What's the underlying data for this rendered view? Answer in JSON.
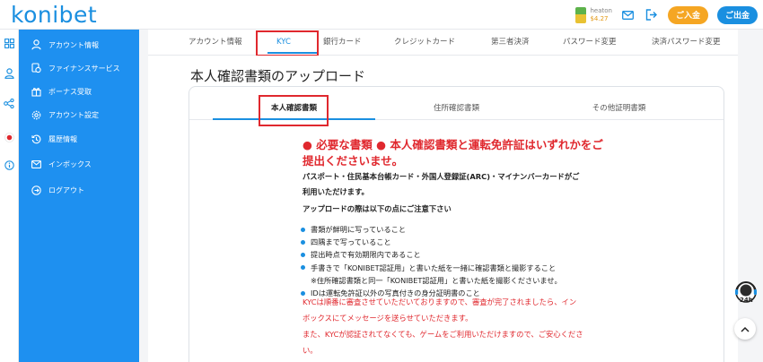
{
  "brand": {
    "logo_text": "konibet",
    "accent": "#1a8fe0",
    "sidebar_bg": "#1e90f0",
    "highlight": "#e0282e"
  },
  "header": {
    "user_name": "heaton",
    "balance": "$4.27",
    "deposit_label": "ご入金",
    "withdraw_label": "ご出金",
    "icons": [
      "mail-icon",
      "logout-icon"
    ]
  },
  "rail": {
    "icons": [
      "grid-icon",
      "user-icon",
      "share-icon",
      "jp-flag-icon",
      "info-icon"
    ]
  },
  "sidebar": {
    "items": [
      {
        "label": "アカウント情報",
        "icon": "user-icon"
      },
      {
        "label": "ファイナンスサービス",
        "icon": "finance-icon"
      },
      {
        "label": "ボーナス受取",
        "icon": "bonus-icon"
      },
      {
        "label": "アカウント設定",
        "icon": "gear-icon"
      },
      {
        "label": "履歴情報",
        "icon": "history-icon"
      },
      {
        "label": "インボックス",
        "icon": "mail-icon"
      },
      {
        "label": "ログアウト",
        "icon": "logout-icon"
      }
    ]
  },
  "tabs": [
    {
      "label": "アカウント情報"
    },
    {
      "label": "KYC"
    },
    {
      "label": "銀行カード"
    },
    {
      "label": "クレジットカード"
    },
    {
      "label": "第三者決済"
    },
    {
      "label": "パスワード変更"
    },
    {
      "label": "決済パスワード変更"
    }
  ],
  "active_tab": "KYC",
  "page": {
    "title": "本人確認書類のアップロード",
    "subtabs": [
      {
        "label": "本人確認書類"
      },
      {
        "label": "住所確認書類"
      },
      {
        "label": "その他証明書類"
      }
    ],
    "required_line1": "● 必要な書類 ● 本人確認書類と運転免許証はいずれかをご",
    "required_line2": "提出くださいませ。",
    "docs_line1": "パスポート・住民基本台帳カード・外国人登録証(ARC)・マイナンバーカードがご",
    "docs_line2": "利用いただけます。",
    "notes_heading": "アップロードの際は以下の点にご注意下さい",
    "bullets": [
      "書類が鮮明に写っていること",
      "四隅まで写っていること",
      "提出時点で有効期限内であること",
      "手書きで「KONIBET認証用」と書いた紙を一緒に確認書類と撮影すること",
      "※住所確認書類と同一「KONIBET認証用」と書いた紙を撮影くださいませ。",
      "IDは運転免許証以外の写真付きの身分証明書のこと"
    ],
    "red_lines": [
      "KYCは順番に審査させていただいておりますので、審査が完了されましたら、イン",
      "ボックスにてメッセージを送らせていただきます。",
      "また、KYCが認証されてなくても、ゲームをご利用いただけますので、ご安心くださ",
      "い。"
    ]
  },
  "floating": {
    "support_label": "24h"
  }
}
